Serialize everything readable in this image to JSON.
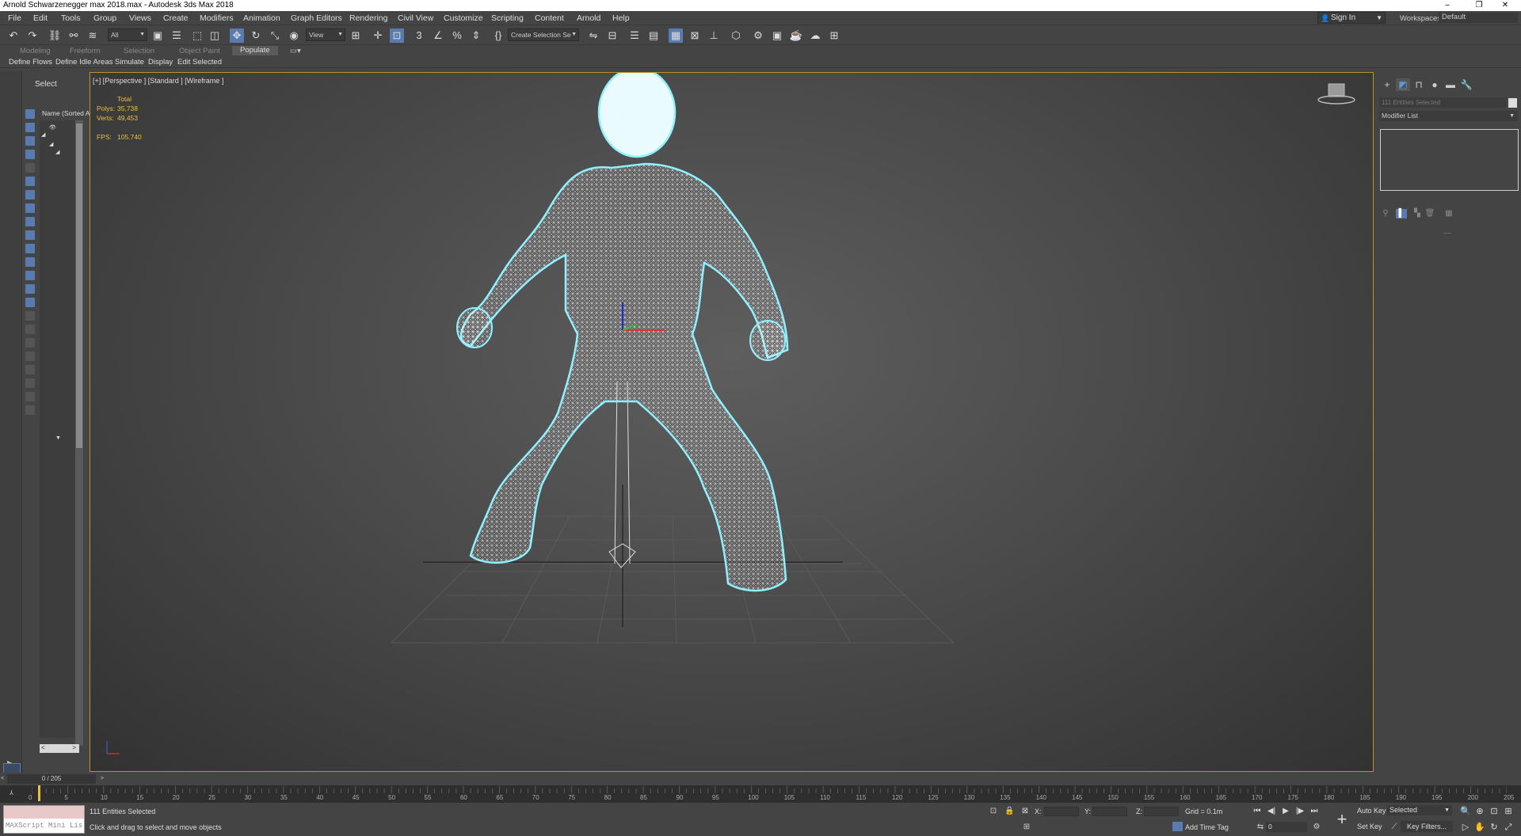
{
  "window": {
    "title": "Arnold Schwarzenegger max 2018.max - Autodesk 3ds Max 2018",
    "minimize": "–",
    "restore": "❐",
    "close": "✕"
  },
  "menu": [
    "File",
    "Edit",
    "Tools",
    "Group",
    "Views",
    "Create",
    "Modifiers",
    "Animation",
    "Graph Editors",
    "Rendering",
    "Civil View",
    "Customize",
    "Scripting",
    "Content",
    "Arnold",
    "Help"
  ],
  "account": {
    "sign_in": "Sign In",
    "workspaces_label": "Workspaces:",
    "workspace": "Default"
  },
  "toolbar": {
    "selection_filter": "All",
    "ref_coord": "View",
    "named_selection": "Create Selection Se"
  },
  "ribbon": {
    "tabs": [
      "Modeling",
      "Freeform",
      "Selection",
      "Object Paint",
      "Populate"
    ],
    "active_tab": "Populate",
    "tools": [
      "Define Flows",
      "Define Idle Areas",
      "Simulate",
      "Display",
      "Edit Selected"
    ]
  },
  "scene_explorer": {
    "select_label": "Select",
    "column_header": "Name (Sorted A"
  },
  "viewport": {
    "label": "[+] [Perspective ] [Standard ] [Wireframe ]",
    "stats": {
      "total_label": "Total",
      "polys_label": "Polys:",
      "polys": "35,738",
      "verts_label": "Verts:",
      "verts": "49,453",
      "fps_label": "FPS:",
      "fps": "105.740"
    }
  },
  "command_panel": {
    "selection_field": "111 Entities Selected",
    "modifier_list": "Modifier List"
  },
  "timeline": {
    "slider": "0 / 205",
    "frame_labels": [
      "0",
      "5",
      "10",
      "15",
      "20",
      "25",
      "30",
      "35",
      "40",
      "45",
      "50",
      "55",
      "60",
      "65",
      "70",
      "75",
      "80",
      "85",
      "90",
      "95",
      "100",
      "105",
      "110",
      "115",
      "120",
      "125",
      "130",
      "135",
      "140",
      "145",
      "150",
      "155",
      "160",
      "165",
      "170",
      "175",
      "180",
      "185",
      "190",
      "195",
      "200",
      "205"
    ]
  },
  "status": {
    "maxscript_placeholder": "MAXScript Mini Lis",
    "selection_info": "111 Entities Selected",
    "prompt": "Click and drag to select and move objects",
    "x_label": "X:",
    "y_label": "Y:",
    "z_label": "Z:",
    "grid": "Grid = 0.1m",
    "add_time_tag": "Add Time Tag",
    "current_frame": "0",
    "auto_key": "Auto Key",
    "set_key": "Set Key",
    "key_mode": "Selected",
    "key_filters": "Key Filters..."
  },
  "colors": {
    "accent": "#5a7bb0",
    "viewport_border": "#b8922a",
    "stats_text": "#e8c040",
    "wireframe": "#ffffff",
    "selection_outline": "#7fe8ff"
  }
}
